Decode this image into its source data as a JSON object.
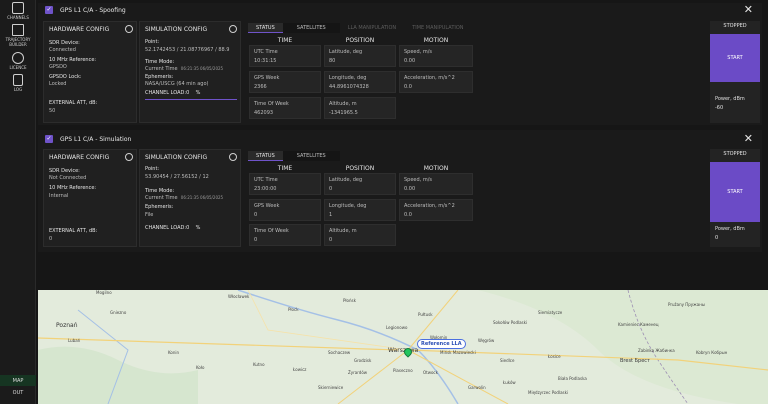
{
  "sidebar": {
    "items": [
      {
        "label": "CHANNELS",
        "icon": "channels-icon"
      },
      {
        "label": "TRAJECTORY BUILDER",
        "icon": "trajectory-icon"
      },
      {
        "label": "LICENCE",
        "icon": "licence-icon"
      },
      {
        "label": "LOG",
        "icon": "log-icon"
      }
    ],
    "bottom": [
      "MAP",
      "OUT"
    ]
  },
  "panels": [
    {
      "title": "GPS L1 C/A - Spoofing",
      "hardware": {
        "title": "HARDWARE CONFIG",
        "sdr_label": "SDR Device:",
        "sdr_value": "Connected",
        "ref_label": "10 MHz Reference:",
        "ref_value": "GPSDO",
        "lock_label": "GPSDO Lock:",
        "lock_value": "Locked",
        "att_label": "EXTERNAL ATT, dB:",
        "att_value": "50"
      },
      "simulation": {
        "title": "SIMULATION CONFIG",
        "point_label": "Point:",
        "point_value": "52.1742453  / 21.08776967  / 88.9",
        "time_mode_label": "Time Mode:",
        "time_mode_value": "Current Time",
        "time_mode_stamp": "06:21:35 06/05/2025",
        "ephemeris_label": "Ephemeris:",
        "ephemeris_value": "NASA/USCG (64 min ago)",
        "load_label": "CHANNEL LOAD:",
        "load_value": "0",
        "load_unit": "%"
      },
      "tabs": [
        "STATUS",
        "SATELLITES",
        "LLA MANIPULATION",
        "TIME MANIPULATION"
      ],
      "columns": [
        "TIME",
        "POSITION",
        "MOTION"
      ],
      "fields": {
        "utc_label": "UTC Time",
        "utc_value": "10:31:15",
        "week_label": "GPS Week",
        "week_value": "2366",
        "tow_label": "Time Of Week",
        "tow_value": "462093",
        "lat_label": "Latitude, deg",
        "lat_value": "80",
        "lon_label": "Longitude, deg",
        "lon_value": "44.8961074328",
        "alt_label": "Altitude, m",
        "alt_value": "-1341965.5",
        "speed_label": "Speed, m/s",
        "speed_value": "0.00",
        "acc_label": "Acceleration, m/s^2",
        "acc_value": "0.0"
      },
      "status": "STOPPED",
      "start_label": "START",
      "power_label": "Power, dBm",
      "power_value": "-60"
    },
    {
      "title": "GPS L1 C/A - Simulation",
      "hardware": {
        "title": "HARDWARE CONFIG",
        "sdr_label": "SDR Device:",
        "sdr_value": "Not Connected",
        "ref_label": "10 MHz Reference:",
        "ref_value": "Internal",
        "att_label": "EXTERNAL ATT, dB:",
        "att_value": "0"
      },
      "simulation": {
        "title": "SIMULATION CONFIG",
        "point_label": "Point:",
        "point_value": "53.90454  / 27.56152  / 12",
        "time_mode_label": "Time Mode:",
        "time_mode_value": "Current Time",
        "time_mode_stamp": "06:21:35 06/05/2025",
        "ephemeris_label": "Ephemeris:",
        "ephemeris_value": "File",
        "load_label": "CHANNEL LOAD:",
        "load_value": "0",
        "load_unit": "%"
      },
      "tabs": [
        "STATUS",
        "SATELLITES"
      ],
      "columns": [
        "TIME",
        "POSITION",
        "MOTION"
      ],
      "fields": {
        "utc_label": "UTC Time",
        "utc_value": "23:00:00",
        "week_label": "GPS Week",
        "week_value": "0",
        "tow_label": "Time Of Week",
        "tow_value": "0",
        "lat_label": "Latitude, deg",
        "lat_value": "0",
        "lon_label": "Longitude, deg",
        "lon_value": "1",
        "alt_label": "Altitude, m",
        "alt_value": "0",
        "speed_label": "Speed, m/s",
        "speed_value": "0.00",
        "acc_label": "Acceleration, m/s^2",
        "acc_value": "0.0"
      },
      "status": "STOPPED",
      "start_label": "START",
      "power_label": "Power, dBm",
      "power_value": "0"
    }
  ],
  "map": {
    "marker_label": "Reference LLA",
    "cities": [
      {
        "name": "Poznań",
        "cls": "big"
      },
      {
        "name": "Warszawa",
        "cls": "big"
      },
      {
        "name": "Brest\nБрест",
        "cls": "med"
      },
      {
        "name": "Włocławek"
      },
      {
        "name": "Płock"
      },
      {
        "name": "Płońsk"
      },
      {
        "name": "Mogilno"
      },
      {
        "name": "Gniezno"
      },
      {
        "name": "Konin"
      },
      {
        "name": "Koło"
      },
      {
        "name": "Kutno"
      },
      {
        "name": "Sochaczew"
      },
      {
        "name": "Łowicz"
      },
      {
        "name": "Skierniewice"
      },
      {
        "name": "Żyrardów"
      },
      {
        "name": "Piaseczno"
      },
      {
        "name": "Otwock"
      },
      {
        "name": "Legionowo"
      },
      {
        "name": "Mińsk Mazowiecki"
      },
      {
        "name": "Wołomin"
      },
      {
        "name": "Węgrów"
      },
      {
        "name": "Siedlce"
      },
      {
        "name": "Sokołów Podlaski"
      },
      {
        "name": "Siemiatycze"
      },
      {
        "name": "Łosice"
      },
      {
        "name": "Biała Podlaska"
      },
      {
        "name": "Międzyrzec Podlaski"
      },
      {
        "name": "Kamieniec Каменец"
      },
      {
        "name": "Pružany Пружаны"
      },
      {
        "name": "Zabinka Жабинка"
      },
      {
        "name": "Kobryn Кобрын"
      },
      {
        "name": "Garwolin"
      },
      {
        "name": "Łuków"
      },
      {
        "name": "Lubań"
      },
      {
        "name": "Pułtusk"
      },
      {
        "name": "Grodzisk"
      }
    ]
  }
}
